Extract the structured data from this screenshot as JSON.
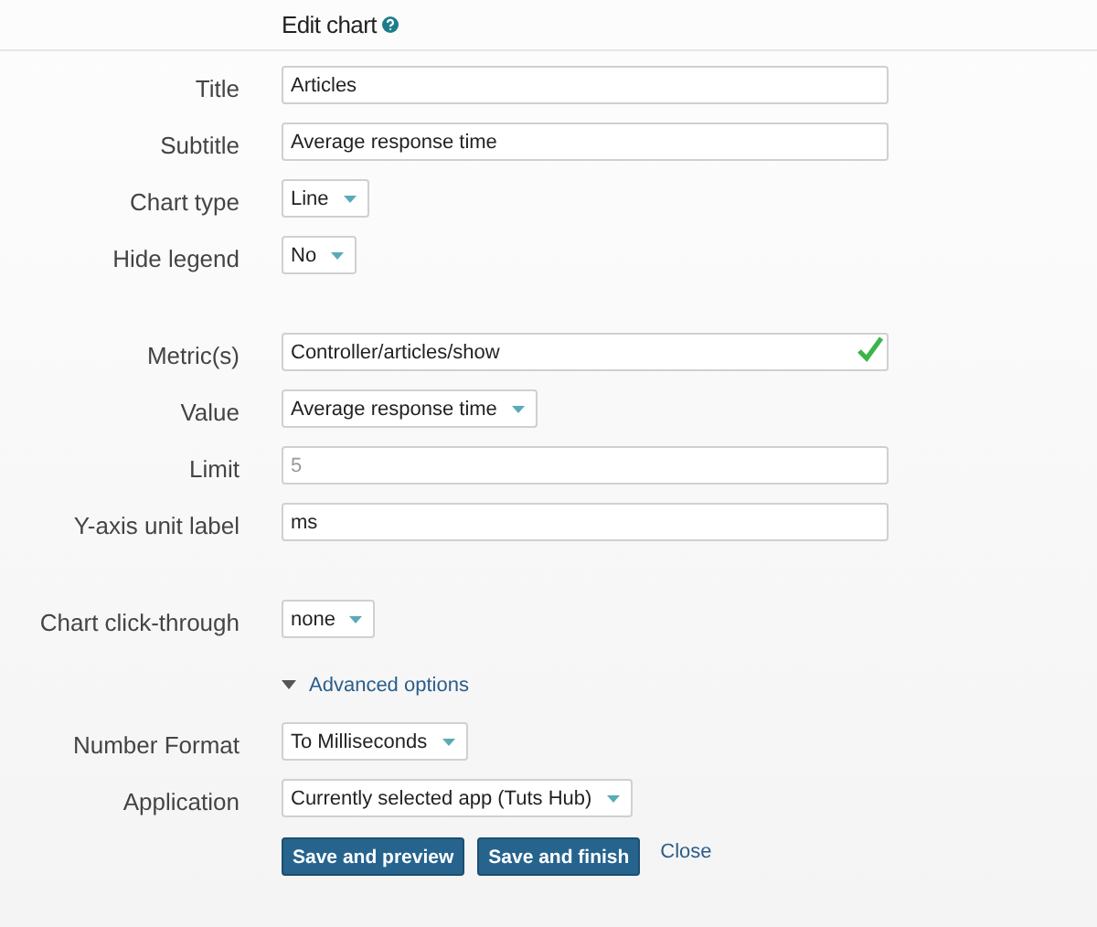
{
  "header": {
    "title": "Edit chart"
  },
  "sections": [
    {
      "fields": [
        {
          "label": "Title",
          "kind": "text",
          "value": "Articles"
        },
        {
          "label": "Subtitle",
          "kind": "text",
          "value": "Average response time"
        },
        {
          "label": "Chart type",
          "kind": "select",
          "value": "Line"
        },
        {
          "label": "Hide legend",
          "kind": "select",
          "value": "No"
        }
      ]
    },
    {
      "fields": [
        {
          "label": "Metric(s)",
          "kind": "text",
          "value": "Controller/articles/show",
          "valid": true
        },
        {
          "label": "Value",
          "kind": "select",
          "value": "Average response time"
        },
        {
          "label": "Limit",
          "kind": "text",
          "placeholder": "5"
        },
        {
          "label": "Y-axis unit label",
          "kind": "text",
          "value": "ms"
        }
      ]
    },
    {
      "fields": [
        {
          "label": "Chart click-through",
          "kind": "select",
          "value": "none"
        }
      ]
    }
  ],
  "advanced": {
    "label": "Advanced options",
    "expanded": true,
    "fields": [
      {
        "label": "Number Format",
        "kind": "select",
        "value": "To Milliseconds"
      },
      {
        "label": "Application",
        "kind": "select",
        "value": "Currently selected app (Tuts Hub)"
      }
    ]
  },
  "buttons": [
    {
      "label": "Save and preview",
      "kind": "primary"
    },
    {
      "label": "Save and finish",
      "kind": "primary"
    },
    {
      "label": "Close",
      "kind": "link"
    }
  ]
}
